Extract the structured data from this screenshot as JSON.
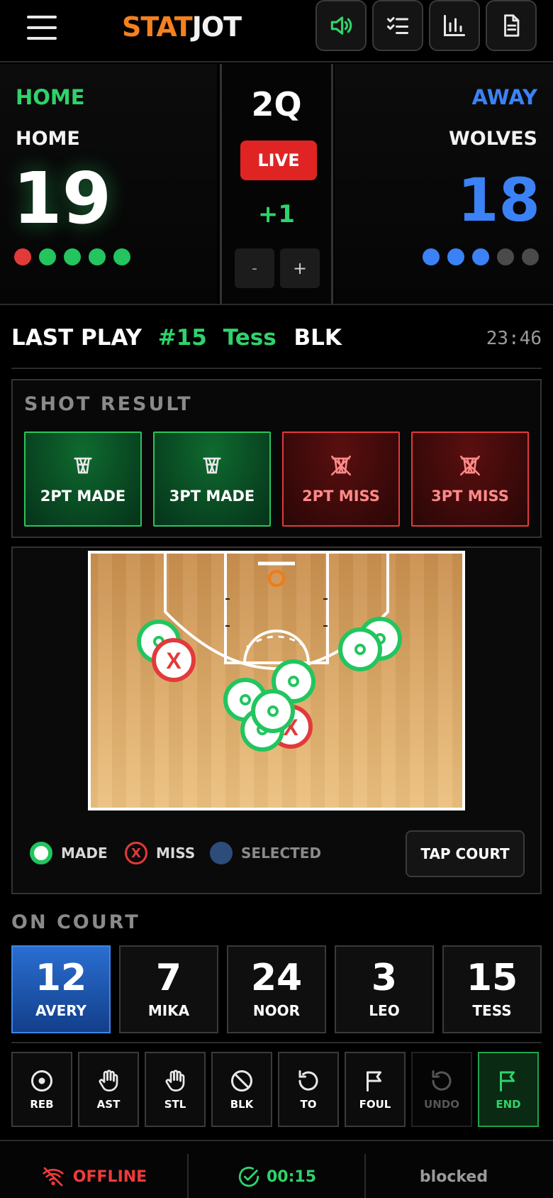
{
  "app": {
    "logo_a": "STAT",
    "logo_b": "JOT"
  },
  "toolbar": {
    "icons": [
      "speaker-icon",
      "checklist-icon",
      "bar-chart-icon",
      "document-icon"
    ]
  },
  "home": {
    "label": "HOME",
    "team": "HOME",
    "score": "19",
    "color": "#2fd36a",
    "fouls": [
      "#e23a3a",
      "#22c55e",
      "#22c55e",
      "#22c55e",
      "#22c55e"
    ]
  },
  "away": {
    "label": "AWAY",
    "team": "WOLVES",
    "score": "18",
    "color": "#3b82f6",
    "fouls": [
      "#3b82f6",
      "#3b82f6",
      "#3b82f6",
      "#4a4a4a",
      "#4a4a4a"
    ]
  },
  "period": {
    "quarter": "2Q",
    "status": "LIVE",
    "delta": "+1",
    "minus": "-",
    "plus": "+"
  },
  "last_play": {
    "label": "LAST PLAY",
    "number": "#15",
    "player": "Tess",
    "action": "BLK",
    "time": "23:46"
  },
  "shot_result": {
    "title": "SHOT RESULT",
    "buttons": [
      {
        "label": "2PT MADE",
        "kind": "made"
      },
      {
        "label": "3PT MADE",
        "kind": "made"
      },
      {
        "label": "2PT MISS",
        "kind": "miss"
      },
      {
        "label": "3PT MISS",
        "kind": "miss"
      }
    ]
  },
  "court": {
    "legend": {
      "made": "MADE",
      "miss": "MISS",
      "selected": "SELECTED"
    },
    "tap_label": "TAP COURT",
    "miss_mark": "X"
  },
  "on_court": {
    "title": "ON COURT",
    "players": [
      {
        "number": "12",
        "name": "AVERY",
        "selected": true
      },
      {
        "number": "7",
        "name": "MIKA",
        "selected": false
      },
      {
        "number": "24",
        "name": "NOOR",
        "selected": false
      },
      {
        "number": "3",
        "name": "LEO",
        "selected": false
      },
      {
        "number": "15",
        "name": "TESS",
        "selected": false
      }
    ]
  },
  "actions": [
    {
      "label": "REB",
      "icon": "target-icon"
    },
    {
      "label": "AST",
      "icon": "hand-icon"
    },
    {
      "label": "STL",
      "icon": "hand-icon"
    },
    {
      "label": "BLK",
      "icon": "block-icon"
    },
    {
      "label": "TO",
      "icon": "rotate-icon"
    },
    {
      "label": "FOUL",
      "icon": "flag-icon"
    },
    {
      "label": "UNDO",
      "icon": "undo-icon"
    },
    {
      "label": "END",
      "icon": "flag-icon"
    }
  ],
  "footer": {
    "offline": "OFFLINE",
    "sync_time": "00:15",
    "status": "blocked"
  }
}
